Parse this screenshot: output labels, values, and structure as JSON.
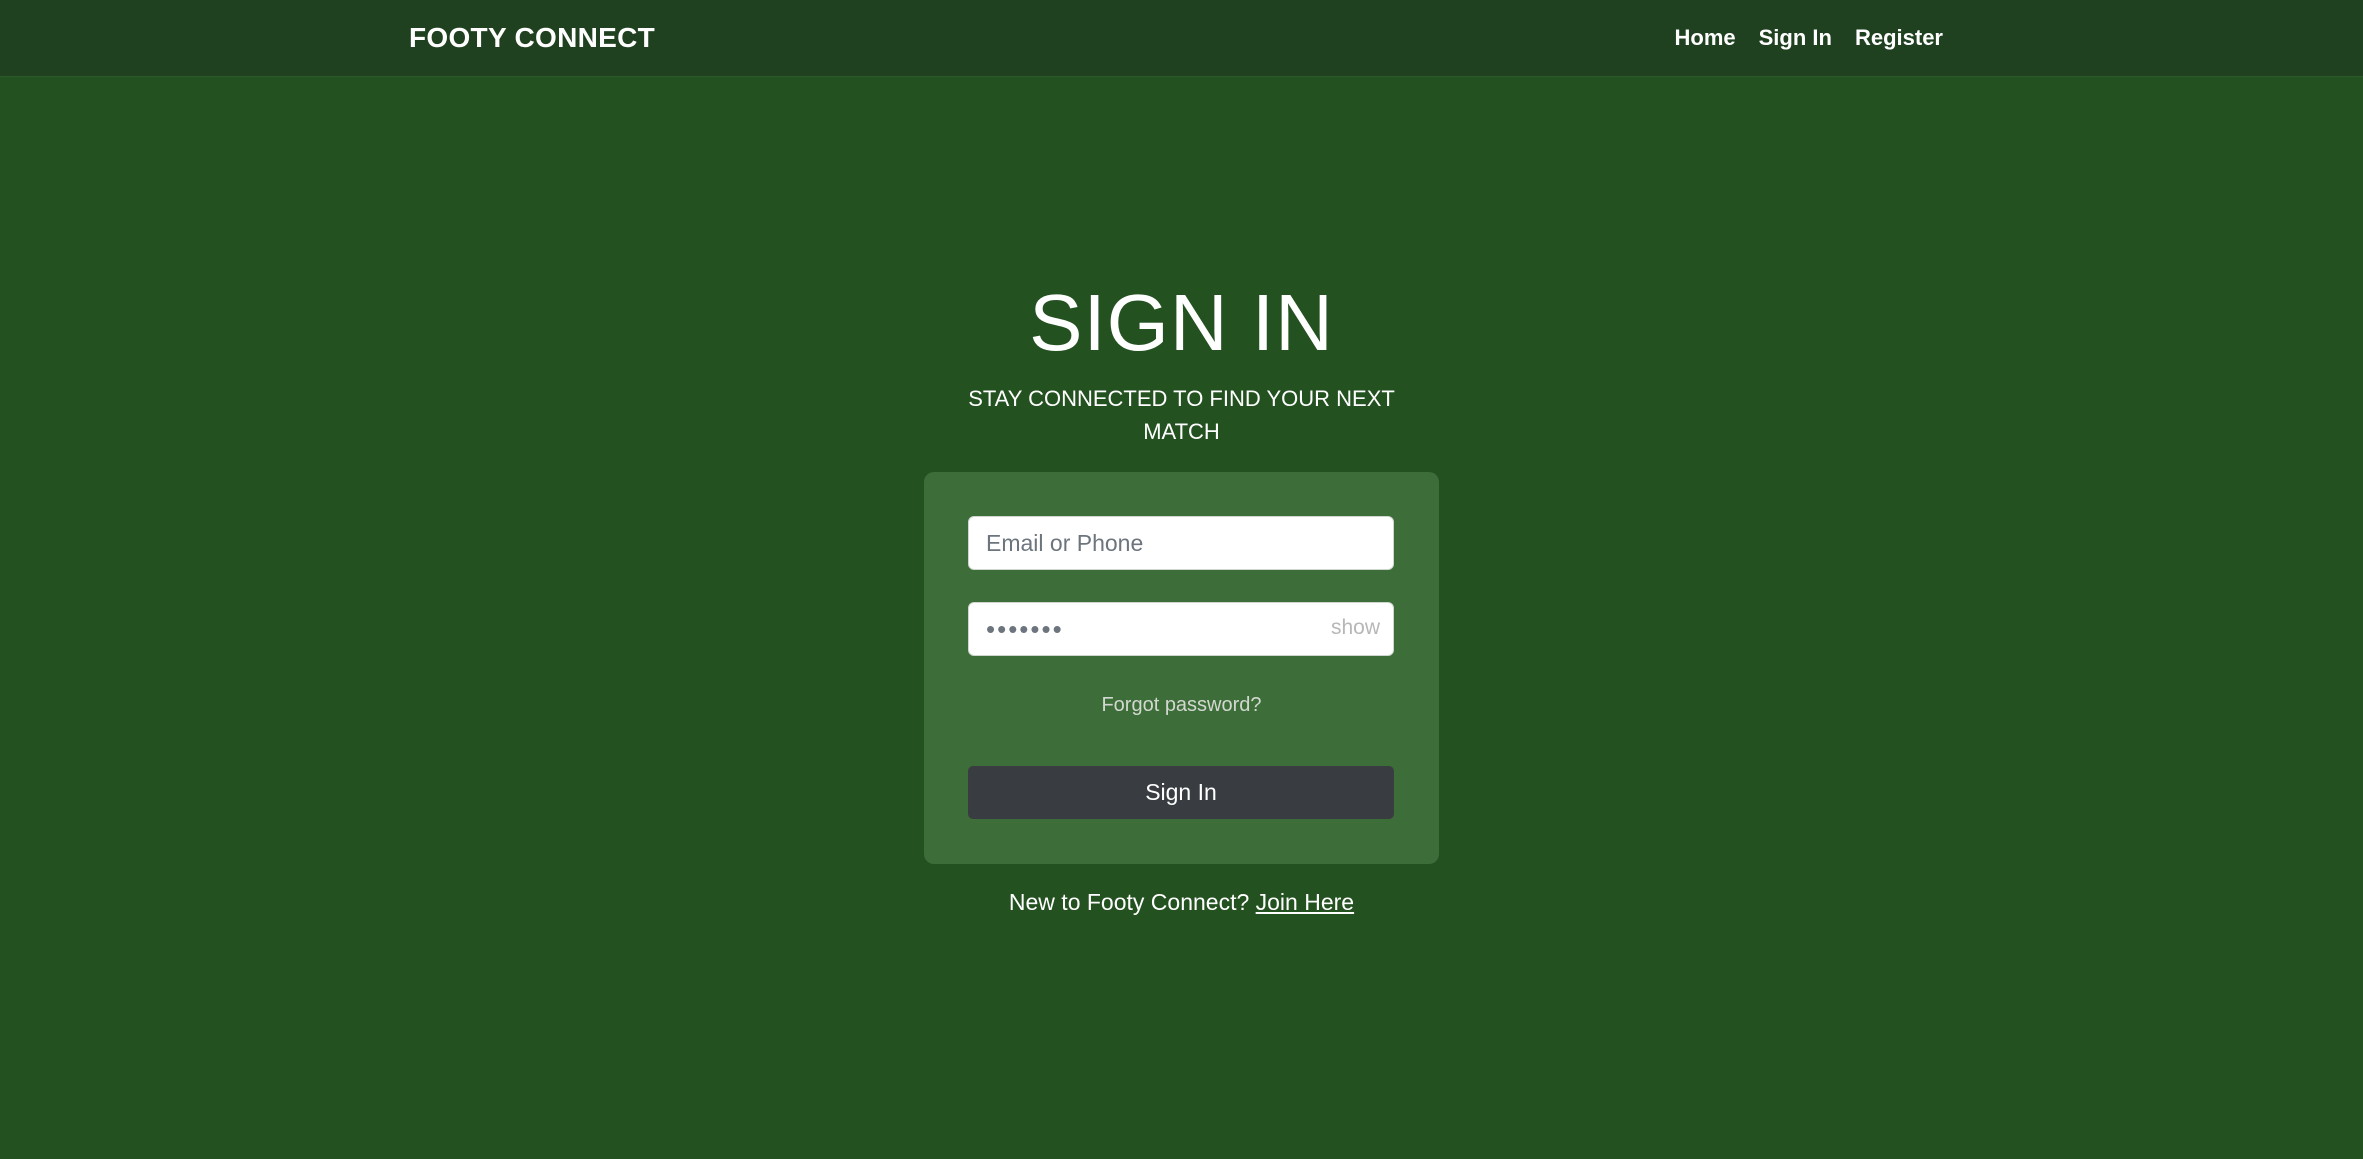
{
  "navbar": {
    "brand": "FOOTY CONNECT",
    "links": [
      {
        "label": "Home"
      },
      {
        "label": "Sign In"
      },
      {
        "label": "Register"
      }
    ]
  },
  "page": {
    "title": "SIGN IN",
    "subtitle": "STAY CONNECTED TO FIND YOUR NEXT MATCH"
  },
  "form": {
    "email_placeholder": "Email or Phone",
    "email_value": "",
    "password_placeholder": "•••••••",
    "password_value": "",
    "show_label": "show",
    "forgot_label": "Forgot password?",
    "submit_label": "Sign In"
  },
  "footer": {
    "prompt": "New to Footy Connect?",
    "join_label": "Join Here"
  },
  "colors": {
    "page_background": "#235120",
    "navbar_background": "#1f4120",
    "card_background": "#3d6d38",
    "button_background": "#393d42"
  }
}
